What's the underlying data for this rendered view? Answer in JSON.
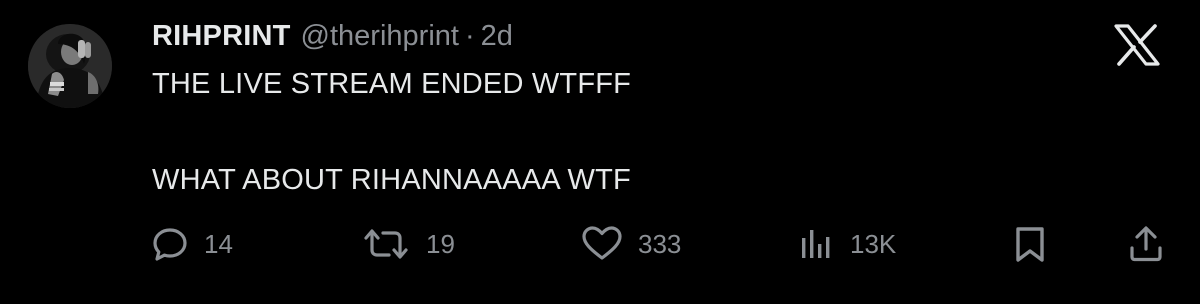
{
  "tweet": {
    "display_name": "RIHPRINT",
    "handle": "@therihprint",
    "separator": "·",
    "time": "2d",
    "text_line_1": "THE LIVE STREAM ENDED WTFFF",
    "text_line_2": "WHAT ABOUT RIHANNAAAAA WTF"
  },
  "actions": {
    "replies": "14",
    "retweets": "19",
    "likes": "333",
    "views": "13K"
  },
  "icons": {
    "brand": "x-logo-icon",
    "reply": "reply-icon",
    "retweet": "retweet-icon",
    "like": "heart-icon",
    "views": "views-icon",
    "bookmark": "bookmark-icon",
    "share": "share-icon"
  },
  "colors": {
    "background": "#000000",
    "primary_text": "#e7e9ea",
    "secondary_text": "#8b8f94"
  }
}
